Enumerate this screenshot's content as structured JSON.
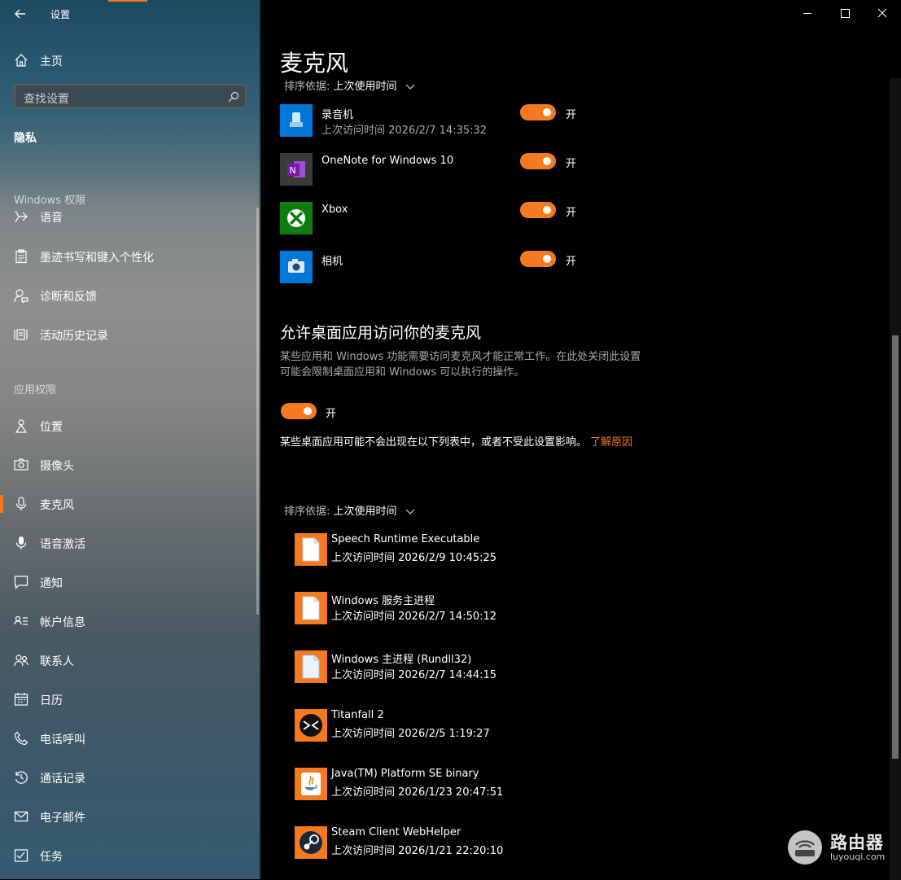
{
  "window": {
    "title": "设置"
  },
  "sidebar": {
    "home_label": "主页",
    "search_placeholder": "查找设置",
    "section_title": "隐私",
    "group_windows": "Windows 权限",
    "items_windows": [
      {
        "label": "语音",
        "icon": "speech-icon"
      },
      {
        "label": "墨迹书写和键入个性化",
        "icon": "clipboard-icon"
      },
      {
        "label": "诊断和反馈",
        "icon": "feedback-icon"
      },
      {
        "label": "活动历史记录",
        "icon": "history-icon"
      }
    ],
    "group_apps": "应用权限",
    "items_apps": [
      {
        "label": "位置",
        "icon": "location-icon"
      },
      {
        "label": "摄像头",
        "icon": "camera-icon"
      },
      {
        "label": "麦克风",
        "icon": "microphone-icon",
        "selected": true
      },
      {
        "label": "语音激活",
        "icon": "voice-activation-icon"
      },
      {
        "label": "通知",
        "icon": "notification-icon"
      },
      {
        "label": "帐户信息",
        "icon": "account-info-icon"
      },
      {
        "label": "联系人",
        "icon": "contacts-icon"
      },
      {
        "label": "日历",
        "icon": "calendar-icon"
      },
      {
        "label": "电话呼叫",
        "icon": "phone-icon"
      },
      {
        "label": "通话记录",
        "icon": "call-history-icon"
      },
      {
        "label": "电子邮件",
        "icon": "email-icon"
      },
      {
        "label": "任务",
        "icon": "tasks-icon"
      }
    ]
  },
  "main": {
    "title": "麦克风",
    "sort_label": "排序依据:",
    "sort_value": "上次使用时间",
    "store_apps": [
      {
        "name": "录音机",
        "sub": "上次访问时间 2026/2/7 14:35:32",
        "toggle": "开",
        "tile_color": "#0078d7",
        "icon": "voice-recorder-icon"
      },
      {
        "name": "OneNote for Windows 10",
        "sub": "",
        "toggle": "开",
        "tile_color": "#3a3a3a",
        "icon": "onenote-icon"
      },
      {
        "name": "Xbox",
        "sub": "",
        "toggle": "开",
        "tile_color": "#107c10",
        "icon": "xbox-icon"
      },
      {
        "name": "相机",
        "sub": "",
        "toggle": "开",
        "tile_color": "#0078d7",
        "icon": "camera-app-icon"
      }
    ],
    "desktop_heading": "允许桌面应用访问你的麦克风",
    "desktop_desc": "某些应用和 Windows 功能需要访问麦克风才能正常工作。在此处关闭此设置可能会限制桌面应用和 Windows 可以执行的操作。",
    "desktop_toggle": "开",
    "desktop_note": "某些桌面应用可能不会出现在以下列表中，或者不受此设置影响。",
    "learn_more": "了解原因",
    "sort_label_2": "排序依据:",
    "sort_value_2": "上次使用时间",
    "desktop_apps": [
      {
        "name": "Speech Runtime Executable",
        "sub": "上次访问时间 2026/2/9 10:45:25",
        "icon": "file-icon"
      },
      {
        "name": "Windows 服务主进程",
        "sub": "上次访问时间 2026/2/7 14:50:12",
        "icon": "file-icon"
      },
      {
        "name": "Windows 主进程 (Rundll32)",
        "sub": "上次访问时间 2026/2/7 14:44:15",
        "icon": "file-icon"
      },
      {
        "name": "Titanfall 2",
        "sub": "上次访问时间 2026/2/5 1:19:27",
        "icon": "titanfall-icon"
      },
      {
        "name": "Java(TM) Platform SE binary",
        "sub": "上次访问时间 2026/1/23 20:47:51",
        "icon": "java-icon"
      },
      {
        "name": "Steam Client WebHelper",
        "sub": "上次访问时间 2026/1/21 22:20:10",
        "icon": "steam-icon"
      }
    ]
  },
  "watermark": {
    "text": "路由器",
    "sub": "luyouqi.com"
  },
  "colors": {
    "accent": "#f47920",
    "background": "#000000"
  }
}
